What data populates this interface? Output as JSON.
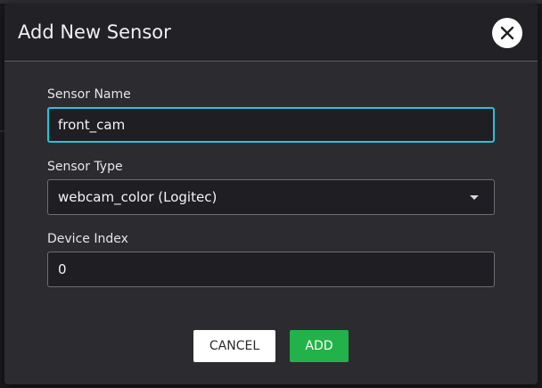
{
  "dialog": {
    "title": "Add New Sensor",
    "close_icon": "close-icon",
    "fields": {
      "sensor_name": {
        "label": "Sensor Name",
        "value": "front_cam"
      },
      "sensor_type": {
        "label": "Sensor Type",
        "selected": "webcam_color (Logitec)",
        "arrow_icon": "dropdown-arrow-icon"
      },
      "device_index": {
        "label": "Device Index",
        "value": "0"
      }
    },
    "buttons": {
      "cancel_label": "CANCEL",
      "add_label": "ADD"
    }
  },
  "colors": {
    "focus_border": "#28c3d9",
    "add_button": "#23b24a",
    "dialog_bg": "#2b2b30",
    "header_bg": "#222226"
  }
}
